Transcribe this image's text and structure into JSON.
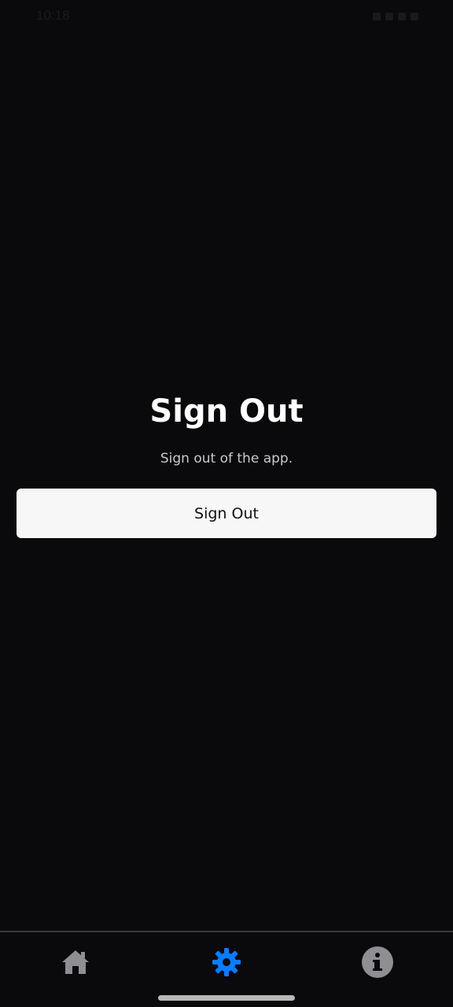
{
  "status_bar": {
    "time": "10:18"
  },
  "main": {
    "title": "Sign Out",
    "subtitle": "Sign out of the app.",
    "signout_button_label": "Sign Out"
  },
  "bottom_nav": {
    "items": [
      {
        "icon": "home-icon",
        "active": false
      },
      {
        "icon": "gear-icon",
        "active": true
      },
      {
        "icon": "info-icon",
        "active": false
      }
    ]
  },
  "colors": {
    "background": "#0a0a0c",
    "accent": "#0a7cff",
    "inactive_icon": "#8e8e93",
    "button_bg": "#f7f7f7"
  }
}
